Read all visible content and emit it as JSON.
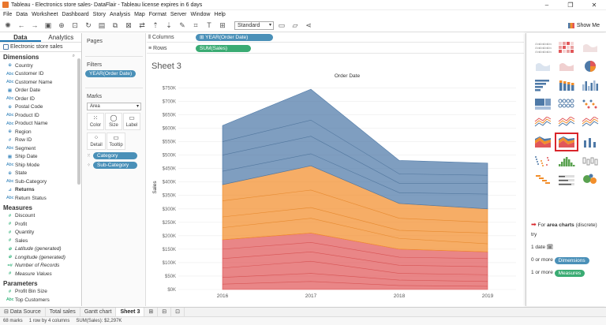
{
  "window": {
    "title": "Tableau - Electronics store sales- DataFlair - Tableau license expires in 6 days"
  },
  "menu": [
    "File",
    "Data",
    "Worksheet",
    "Dashboard",
    "Story",
    "Analysis",
    "Map",
    "Format",
    "Server",
    "Window",
    "Help"
  ],
  "toolbar": {
    "fit_select": "Standard",
    "show_me_label": "Show Me"
  },
  "left_pane": {
    "tabs": [
      "Data",
      "Analytics"
    ],
    "data_source": "Electronic store sales",
    "dimensions_header": "Dimensions",
    "dimensions": [
      {
        "icon": "globe",
        "label": "Country"
      },
      {
        "icon": "abc",
        "label": "Customer ID"
      },
      {
        "icon": "abc",
        "label": "Customer Name"
      },
      {
        "icon": "date",
        "label": "Order Date"
      },
      {
        "icon": "abc",
        "label": "Order ID"
      },
      {
        "icon": "globe",
        "label": "Postal Code"
      },
      {
        "icon": "abc",
        "label": "Product ID"
      },
      {
        "icon": "abc",
        "label": "Product Name"
      },
      {
        "icon": "globe",
        "label": "Region"
      },
      {
        "icon": "#",
        "label": "Row ID"
      },
      {
        "icon": "abc",
        "label": "Segment"
      },
      {
        "icon": "date",
        "label": "Ship Date"
      },
      {
        "icon": "abc",
        "label": "Ship Mode"
      },
      {
        "icon": "globe",
        "label": "State"
      },
      {
        "icon": "abc",
        "label": "Sub-Category"
      },
      {
        "icon": "hier",
        "label": "Returns"
      },
      {
        "icon": "abc",
        "label": "Return Status"
      }
    ],
    "measures_header": "Measures",
    "measures": [
      {
        "icon": "#",
        "label": "Discount",
        "italic": false
      },
      {
        "icon": "#",
        "label": "Profit",
        "italic": false
      },
      {
        "icon": "#",
        "label": "Quantity",
        "italic": false
      },
      {
        "icon": "#",
        "label": "Sales",
        "italic": false
      },
      {
        "icon": "globe",
        "label": "Latitude (generated)",
        "italic": true
      },
      {
        "icon": "globe",
        "label": "Longitude (generated)",
        "italic": true
      },
      {
        "icon": "=#",
        "label": "Number of Records",
        "italic": true
      },
      {
        "icon": "#",
        "label": "Measure Values",
        "italic": true
      }
    ],
    "parameters_header": "Parameters",
    "parameters": [
      {
        "icon": "#",
        "label": "Profit Bin Size"
      },
      {
        "icon": "abc",
        "label": "Top Customers"
      }
    ]
  },
  "shelves": {
    "pages_label": "Pages",
    "filters_label": "Filters",
    "filter_pill": "YEAR(Order Date)",
    "marks_label": "Marks",
    "mark_type": "Area",
    "mark_buttons": [
      {
        "glyph": "⁙",
        "label": "Color"
      },
      {
        "glyph": "◯",
        "label": "Size"
      },
      {
        "glyph": "▭",
        "label": "Label"
      },
      {
        "glyph": "⁘",
        "label": "Detail"
      },
      {
        "glyph": "▭",
        "label": "Tooltip"
      }
    ],
    "mark_pills": [
      {
        "icon": "⁙",
        "label": "Category"
      },
      {
        "icon": "⁘",
        "label": "Sub-Category"
      }
    ],
    "columns_label": "Columns",
    "columns_pill": "⊞ YEAR(Order Date)",
    "rows_label": "Rows",
    "rows_pill": "SUM(Sales)"
  },
  "view": {
    "sheet_title": "Sheet 3"
  },
  "chart_data": {
    "type": "area",
    "title": "Order Date",
    "xlabel": "",
    "ylabel": "Sales",
    "x": [
      "2016",
      "2017",
      "2018",
      "2019"
    ],
    "ytick_labels": [
      "$0K",
      "$50K",
      "$100K",
      "$150K",
      "$200K",
      "$250K",
      "$300K",
      "$350K",
      "$400K",
      "$450K",
      "$500K",
      "$550K",
      "$600K",
      "$650K",
      "$700K",
      "$750K"
    ],
    "ylim": [
      0,
      760000
    ],
    "grid": true,
    "stacked": true,
    "series": [
      {
        "color": "#e15759",
        "values": [
          185000,
          210000,
          150000,
          140000
        ]
      },
      {
        "color": "#f28e2b",
        "values": [
          205000,
          250000,
          170000,
          160000
        ]
      },
      {
        "color": "#4e79a7",
        "values": [
          220000,
          285000,
          160000,
          170000
        ]
      }
    ],
    "band_lines": {
      "red": [
        [
          20000,
          30000,
          15000,
          12000
        ],
        [
          45000,
          60000,
          35000,
          30000
        ],
        [
          80000,
          105000,
          60000,
          55000
        ],
        [
          115000,
          140000,
          90000,
          85000
        ],
        [
          150000,
          175000,
          120000,
          115000
        ]
      ],
      "orange": [
        [
          230000,
          265000,
          190000,
          170000
        ],
        [
          270000,
          305000,
          220000,
          210000
        ],
        [
          330000,
          370000,
          265000,
          250000
        ]
      ],
      "blue": [
        [
          440000,
          505000,
          360000,
          355000
        ],
        [
          500000,
          570000,
          395000,
          395000
        ],
        [
          550000,
          630000,
          430000,
          425000
        ]
      ]
    }
  },
  "show_me": {
    "help_prefix": "For",
    "help_bold": "area charts",
    "help_suffix": "(discrete) try",
    "req_date": "1 date",
    "req_dims_prefix": "0 or more",
    "req_dims_pill": "Dimensions",
    "req_meas_prefix": "1 or more",
    "req_meas_pill": "Measures"
  },
  "bottom_tabs": [
    "Data Source",
    "Total sales",
    "Gantt chart",
    "Sheet 3"
  ],
  "status": {
    "marks": "68 marks",
    "rows": "1 row by 4 columns",
    "sum": "SUM(Sales): $2,297K"
  }
}
